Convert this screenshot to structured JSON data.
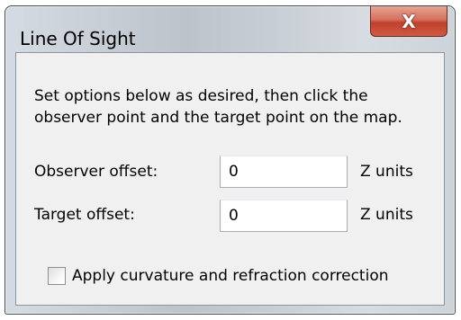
{
  "window": {
    "title": "Line Of Sight",
    "close_label": "X"
  },
  "instructions": {
    "line1": "Set options below as desired, then click the",
    "line2": "observer point and the target point on the map."
  },
  "observer": {
    "label": "Observer offset:",
    "value": "0",
    "units": "Z units"
  },
  "target": {
    "label": "Target offset:",
    "value": "0",
    "units": "Z units"
  },
  "curvature": {
    "label": "Apply curvature and refraction correction",
    "checked": false
  }
}
